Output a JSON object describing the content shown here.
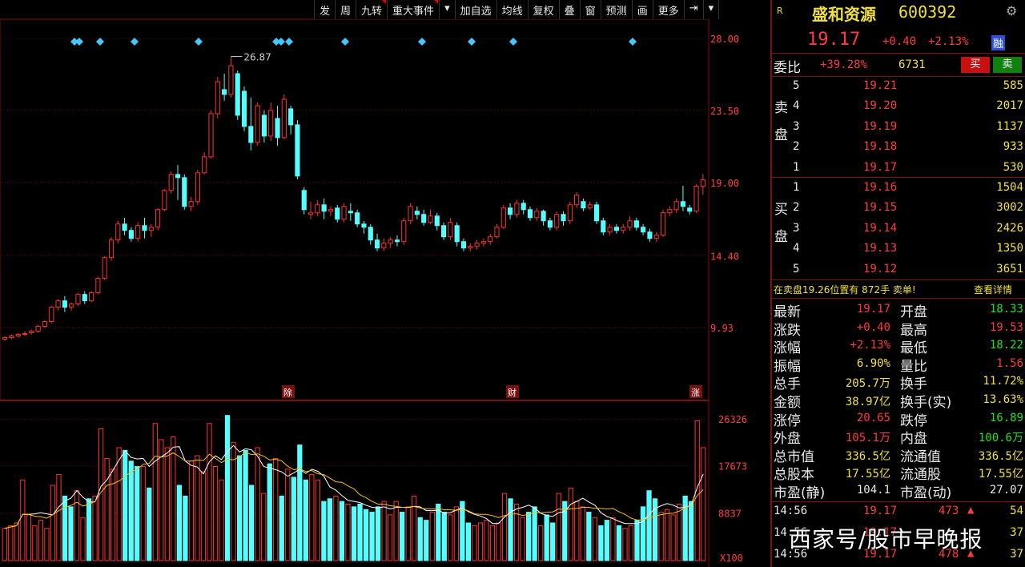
{
  "toolbar": {
    "items": [
      "发",
      "周",
      "九转",
      "重大事件",
      "▾",
      "加自选",
      "均线",
      "复权",
      "叠",
      "窗",
      "预测",
      "画",
      "更多",
      "⇥",
      "▾"
    ]
  },
  "chart_data": [
    {
      "type": "candlestick",
      "title": "",
      "ylim": [
        6.0,
        30.0
      ],
      "y_ticks": [
        "28.00",
        "23.50",
        "19.00",
        "14.40",
        "9.93"
      ],
      "y_tick_values": [
        28.0,
        23.5,
        19.0,
        14.4,
        9.93
      ],
      "peak_label": "26.87",
      "peak_value": 26.87,
      "markers": [
        "除",
        "财",
        "涨"
      ],
      "candles": [
        {
          "o": 9.2,
          "c": 9.3,
          "h": 9.4,
          "l": 9.1
        },
        {
          "o": 9.3,
          "c": 9.4,
          "h": 9.5,
          "l": 9.2
        },
        {
          "o": 9.4,
          "c": 9.5,
          "h": 9.6,
          "l": 9.3
        },
        {
          "o": 9.5,
          "c": 9.55,
          "h": 9.7,
          "l": 9.4
        },
        {
          "o": 9.6,
          "c": 9.7,
          "h": 9.8,
          "l": 9.5
        },
        {
          "o": 9.7,
          "c": 10.0,
          "h": 10.1,
          "l": 9.6
        },
        {
          "o": 10.0,
          "c": 10.3,
          "h": 10.4,
          "l": 9.9
        },
        {
          "o": 10.3,
          "c": 11.2,
          "h": 11.3,
          "l": 10.2
        },
        {
          "o": 11.2,
          "c": 11.6,
          "h": 11.7,
          "l": 11.0
        },
        {
          "o": 11.6,
          "c": 11.2,
          "h": 11.9,
          "l": 10.9
        },
        {
          "o": 11.2,
          "c": 11.4,
          "h": 11.5,
          "l": 11.0
        },
        {
          "o": 11.4,
          "c": 12.0,
          "h": 12.1,
          "l": 11.3
        },
        {
          "o": 12.0,
          "c": 11.6,
          "h": 12.2,
          "l": 11.4
        },
        {
          "o": 11.6,
          "c": 12.1,
          "h": 12.2,
          "l": 11.5
        },
        {
          "o": 12.1,
          "c": 13.0,
          "h": 13.1,
          "l": 12.0
        },
        {
          "o": 13.0,
          "c": 14.3,
          "h": 14.4,
          "l": 12.9
        },
        {
          "o": 14.3,
          "c": 15.4,
          "h": 15.6,
          "l": 14.1
        },
        {
          "o": 15.4,
          "c": 16.4,
          "h": 16.6,
          "l": 15.2
        },
        {
          "o": 16.4,
          "c": 16.0,
          "h": 16.8,
          "l": 15.7
        },
        {
          "o": 16.0,
          "c": 15.5,
          "h": 16.2,
          "l": 15.3
        },
        {
          "o": 15.5,
          "c": 16.3,
          "h": 16.5,
          "l": 15.3
        },
        {
          "o": 16.3,
          "c": 16.0,
          "h": 16.8,
          "l": 15.5
        },
        {
          "o": 16.0,
          "c": 16.2,
          "h": 16.4,
          "l": 15.6
        },
        {
          "o": 16.2,
          "c": 17.3,
          "h": 17.4,
          "l": 16.0
        },
        {
          "o": 17.3,
          "c": 18.5,
          "h": 18.6,
          "l": 17.2
        },
        {
          "o": 18.5,
          "c": 19.5,
          "h": 19.7,
          "l": 18.3
        },
        {
          "o": 19.5,
          "c": 19.3,
          "h": 20.1,
          "l": 17.9
        },
        {
          "o": 19.3,
          "c": 17.5,
          "h": 19.5,
          "l": 17.3
        },
        {
          "o": 17.5,
          "c": 17.8,
          "h": 18.1,
          "l": 17.2
        },
        {
          "o": 17.8,
          "c": 19.6,
          "h": 19.8,
          "l": 17.6
        },
        {
          "o": 19.6,
          "c": 20.6,
          "h": 20.9,
          "l": 19.5
        },
        {
          "o": 20.6,
          "c": 23.3,
          "h": 23.5,
          "l": 20.5
        },
        {
          "o": 23.3,
          "c": 25.3,
          "h": 25.6,
          "l": 23.0
        },
        {
          "o": 24.8,
          "c": 24.5,
          "h": 25.8,
          "l": 24.1
        },
        {
          "o": 24.5,
          "c": 26.3,
          "h": 26.87,
          "l": 24.3
        },
        {
          "o": 25.8,
          "c": 23.2,
          "h": 26.0,
          "l": 22.9
        },
        {
          "o": 24.7,
          "c": 22.5,
          "h": 25.0,
          "l": 22.2
        },
        {
          "o": 22.5,
          "c": 21.5,
          "h": 24.3,
          "l": 21.0
        },
        {
          "o": 21.5,
          "c": 23.8,
          "h": 24.0,
          "l": 21.3
        },
        {
          "o": 23.2,
          "c": 21.9,
          "h": 23.5,
          "l": 21.5
        },
        {
          "o": 21.9,
          "c": 23.5,
          "h": 24.0,
          "l": 21.6
        },
        {
          "o": 23.0,
          "c": 21.8,
          "h": 23.8,
          "l": 21.3
        },
        {
          "o": 21.8,
          "c": 24.2,
          "h": 24.5,
          "l": 21.7
        },
        {
          "o": 23.6,
          "c": 22.6,
          "h": 23.8,
          "l": 22.0
        },
        {
          "o": 22.6,
          "c": 19.4,
          "h": 22.9,
          "l": 19.2
        },
        {
          "o": 18.5,
          "c": 17.3,
          "h": 18.7,
          "l": 17.0
        },
        {
          "o": 17.0,
          "c": 17.1,
          "h": 17.8,
          "l": 16.7
        },
        {
          "o": 17.1,
          "c": 17.6,
          "h": 17.9,
          "l": 16.9
        },
        {
          "o": 17.6,
          "c": 17.2,
          "h": 18.0,
          "l": 16.7
        },
        {
          "o": 17.2,
          "c": 17.3,
          "h": 17.5,
          "l": 16.9
        },
        {
          "o": 17.4,
          "c": 16.7,
          "h": 17.6,
          "l": 16.5
        },
        {
          "o": 16.7,
          "c": 17.5,
          "h": 17.7,
          "l": 16.5
        },
        {
          "o": 17.2,
          "c": 17.1,
          "h": 17.7,
          "l": 16.6
        },
        {
          "o": 17.1,
          "c": 16.4,
          "h": 17.3,
          "l": 16.2
        },
        {
          "o": 16.4,
          "c": 16.2,
          "h": 16.6,
          "l": 15.8
        },
        {
          "o": 16.2,
          "c": 15.4,
          "h": 16.4,
          "l": 15.1
        },
        {
          "o": 15.4,
          "c": 14.9,
          "h": 15.8,
          "l": 14.7
        },
        {
          "o": 14.9,
          "c": 15.2,
          "h": 15.5,
          "l": 14.7
        },
        {
          "o": 15.2,
          "c": 15.4,
          "h": 15.6,
          "l": 14.9
        },
        {
          "o": 15.4,
          "c": 15.3,
          "h": 15.7,
          "l": 15.0
        },
        {
          "o": 15.3,
          "c": 16.6,
          "h": 16.8,
          "l": 15.1
        },
        {
          "o": 16.6,
          "c": 17.5,
          "h": 17.7,
          "l": 16.4
        },
        {
          "o": 17.2,
          "c": 17.0,
          "h": 17.5,
          "l": 16.7
        },
        {
          "o": 17.0,
          "c": 16.5,
          "h": 17.3,
          "l": 16.3
        },
        {
          "o": 16.5,
          "c": 16.9,
          "h": 17.3,
          "l": 16.4
        },
        {
          "o": 16.9,
          "c": 16.3,
          "h": 17.1,
          "l": 16.0
        },
        {
          "o": 16.3,
          "c": 15.6,
          "h": 16.5,
          "l": 15.4
        },
        {
          "o": 15.6,
          "c": 16.5,
          "h": 16.8,
          "l": 15.4
        },
        {
          "o": 16.3,
          "c": 15.3,
          "h": 16.5,
          "l": 15.0
        },
        {
          "o": 15.3,
          "c": 14.9,
          "h": 15.5,
          "l": 14.7
        },
        {
          "o": 14.9,
          "c": 15.0,
          "h": 15.2,
          "l": 14.7
        },
        {
          "o": 15.0,
          "c": 15.2,
          "h": 15.4,
          "l": 14.8
        },
        {
          "o": 15.2,
          "c": 15.3,
          "h": 15.5,
          "l": 15.0
        },
        {
          "o": 15.3,
          "c": 15.6,
          "h": 15.8,
          "l": 15.1
        },
        {
          "o": 15.6,
          "c": 16.2,
          "h": 16.4,
          "l": 15.5
        },
        {
          "o": 16.2,
          "c": 17.4,
          "h": 17.6,
          "l": 16.1
        },
        {
          "o": 17.4,
          "c": 17.0,
          "h": 17.7,
          "l": 16.7
        },
        {
          "o": 17.0,
          "c": 17.7,
          "h": 17.9,
          "l": 16.8
        },
        {
          "o": 17.7,
          "c": 17.3,
          "h": 17.9,
          "l": 17.0
        },
        {
          "o": 17.3,
          "c": 16.8,
          "h": 17.5,
          "l": 16.6
        },
        {
          "o": 16.8,
          "c": 17.2,
          "h": 17.4,
          "l": 16.6
        },
        {
          "o": 17.2,
          "c": 16.6,
          "h": 17.3,
          "l": 16.3
        },
        {
          "o": 16.6,
          "c": 16.2,
          "h": 16.8,
          "l": 16.0
        },
        {
          "o": 16.2,
          "c": 17.0,
          "h": 17.2,
          "l": 16.0
        },
        {
          "o": 17.0,
          "c": 16.6,
          "h": 17.2,
          "l": 16.3
        },
        {
          "o": 16.6,
          "c": 17.6,
          "h": 17.8,
          "l": 16.4
        },
        {
          "o": 17.6,
          "c": 18.2,
          "h": 18.4,
          "l": 17.4
        },
        {
          "o": 17.8,
          "c": 17.4,
          "h": 18.0,
          "l": 17.2
        },
        {
          "o": 17.4,
          "c": 17.6,
          "h": 17.8,
          "l": 17.3
        },
        {
          "o": 17.6,
          "c": 16.6,
          "h": 17.8,
          "l": 16.4
        },
        {
          "o": 16.6,
          "c": 15.9,
          "h": 16.8,
          "l": 15.7
        },
        {
          "o": 15.9,
          "c": 16.2,
          "h": 16.4,
          "l": 15.7
        },
        {
          "o": 16.2,
          "c": 16.0,
          "h": 16.4,
          "l": 15.8
        },
        {
          "o": 16.0,
          "c": 16.2,
          "h": 16.4,
          "l": 15.8
        },
        {
          "o": 16.2,
          "c": 16.6,
          "h": 16.9,
          "l": 16.0
        },
        {
          "o": 16.6,
          "c": 16.2,
          "h": 16.8,
          "l": 16.0
        },
        {
          "o": 16.2,
          "c": 15.9,
          "h": 16.4,
          "l": 15.7
        },
        {
          "o": 15.9,
          "c": 15.5,
          "h": 16.1,
          "l": 15.3
        },
        {
          "o": 15.5,
          "c": 15.7,
          "h": 15.9,
          "l": 15.3
        },
        {
          "o": 15.7,
          "c": 17.1,
          "h": 17.3,
          "l": 15.6
        },
        {
          "o": 17.1,
          "c": 17.3,
          "h": 17.5,
          "l": 16.9
        },
        {
          "o": 17.3,
          "c": 17.8,
          "h": 18.0,
          "l": 17.1
        },
        {
          "o": 17.8,
          "c": 17.5,
          "h": 18.8,
          "l": 17.2
        },
        {
          "o": 17.4,
          "c": 17.2,
          "h": 17.6,
          "l": 17.0
        },
        {
          "o": 17.2,
          "c": 18.77,
          "h": 18.9,
          "l": 17.1
        },
        {
          "o": 18.77,
          "c": 19.17,
          "h": 19.53,
          "l": 18.22
        }
      ]
    },
    {
      "type": "bar",
      "title": "",
      "y_ticks": [
        "26326",
        "17673",
        "8837",
        "X100"
      ],
      "ylim": [
        0,
        28000
      ],
      "series": [
        {
          "values": [
            6000,
            6500,
            7000,
            15000,
            8500,
            6500,
            7500,
            6000,
            14000,
            16000,
            12000,
            10000,
            13000,
            8000,
            11500,
            12000,
            24500,
            19000,
            17000,
            21000,
            20500,
            18500,
            17500,
            17500,
            13500,
            25500,
            22500,
            21000,
            23000,
            14000,
            12000,
            18500,
            19500,
            16500,
            25500,
            17500,
            15000,
            27000,
            22000,
            19500,
            20500,
            14000,
            21000,
            12500,
            18000,
            19000,
            12000,
            17000,
            15500,
            21500,
            15000,
            16000,
            15000,
            11000,
            11500,
            12000,
            11000,
            10500,
            10000,
            10500,
            9500,
            9000,
            10000,
            11000,
            8500,
            11000,
            9000,
            10000,
            12000,
            8000,
            7500,
            9000,
            10500,
            9000,
            8500,
            10000,
            11000,
            7000,
            6500,
            7000,
            7500,
            6500,
            7000,
            12500,
            11500,
            10500,
            8000,
            9000,
            10000,
            6500,
            8500,
            7000,
            12500,
            11000,
            13500,
            11000,
            10000,
            9000,
            8000,
            6500,
            7500,
            8000,
            6500,
            6000,
            6500,
            7500,
            10000,
            13000,
            11500,
            9000,
            9500,
            8500,
            10500,
            12000,
            11000,
            26000,
            21000
          ]
        }
      ],
      "ma_lines": [
        "MA5",
        "MA10"
      ]
    }
  ],
  "quote": {
    "market": "R",
    "name": "盛和资源",
    "code": "600392",
    "price": "19.17",
    "change": "+0.40",
    "pct": "+2.13%",
    "tag": "融",
    "wb_label": "委比",
    "wb_pct": "+39.28%",
    "wb_vol": "6731",
    "buy_btn": "买",
    "sell_btn": "卖"
  },
  "sell_label": [
    "卖",
    "盘"
  ],
  "buy_label": [
    "买",
    "盘"
  ],
  "sells": [
    {
      "n": "5",
      "p": "19.21",
      "v": "585"
    },
    {
      "n": "4",
      "p": "19.20",
      "v": "2017"
    },
    {
      "n": "3",
      "p": "19.19",
      "v": "1137"
    },
    {
      "n": "2",
      "p": "19.18",
      "v": "933"
    },
    {
      "n": "1",
      "p": "19.17",
      "v": "530"
    }
  ],
  "buys": [
    {
      "n": "1",
      "p": "19.16",
      "v": "1504"
    },
    {
      "n": "2",
      "p": "19.15",
      "v": "3002"
    },
    {
      "n": "3",
      "p": "19.14",
      "v": "2426"
    },
    {
      "n": "4",
      "p": "19.13",
      "v": "1350"
    },
    {
      "n": "5",
      "p": "19.12",
      "v": "3651"
    }
  ],
  "notice": {
    "text": "在卖盘19.26位置有 872手 卖单!",
    "link": "查看详情"
  },
  "stats": [
    {
      "l1": "最新",
      "v1": "19.17",
      "c1": "red",
      "l2": "开盘",
      "v2": "18.33",
      "c2": "green"
    },
    {
      "l1": "涨跌",
      "v1": "+0.40",
      "c1": "red",
      "l2": "最高",
      "v2": "19.53",
      "c2": "red"
    },
    {
      "l1": "涨幅",
      "v1": "+2.13%",
      "c1": "red",
      "l2": "最低",
      "v2": "18.22",
      "c2": "green"
    },
    {
      "l1": "振幅",
      "v1": "6.90%",
      "c1": "yellow",
      "l2": "量比",
      "v2": "1.56",
      "c2": "red"
    },
    {
      "l1": "总手",
      "v1": "205.7万",
      "c1": "yellow",
      "l2": "换手",
      "v2": "11.72%",
      "c2": "yellow"
    },
    {
      "l1": "金额",
      "v1": "38.97亿",
      "c1": "yellow",
      "l2": "换手(实)",
      "v2": "13.63%",
      "c2": "yellow"
    },
    {
      "l1": "涨停",
      "v1": "20.65",
      "c1": "red",
      "l2": "跌停",
      "v2": "16.89",
      "c2": "green"
    },
    {
      "l1": "外盘",
      "v1": "105.1万",
      "c1": "red",
      "l2": "内盘",
      "v2": "100.6万",
      "c2": "green"
    },
    {
      "l1": "总市值",
      "v1": "336.5亿",
      "c1": "yellow",
      "l2": "流通值",
      "v2": "336.5亿",
      "c2": "yellow"
    },
    {
      "l1": "总股本",
      "v1": "17.55亿",
      "c1": "yellow",
      "l2": "流通股",
      "v2": "17.55亿",
      "c2": "yellow"
    },
    {
      "l1": "市盈(静)",
      "v1": "104.1",
      "c1": "white",
      "l2": "市盈(动)",
      "v2": "27.07",
      "c2": "white"
    }
  ],
  "ticks": [
    {
      "t": "14:56",
      "p": "19.17",
      "v": "473",
      "n": "54"
    },
    {
      "t": "14:56",
      "p": "19.17",
      "v": "",
      "n": "37"
    },
    {
      "t": "14:56",
      "p": "19.17",
      "v": "478",
      "n": "37"
    }
  ],
  "watermark": "西家号/股市早晚报",
  "colors": {
    "up": "#ff3232",
    "down": "#54ffff",
    "panel_border": "#7a1010",
    "ma5": "#ffffff",
    "ma10": "#f0c020",
    "diamond": "#40c8ff"
  }
}
